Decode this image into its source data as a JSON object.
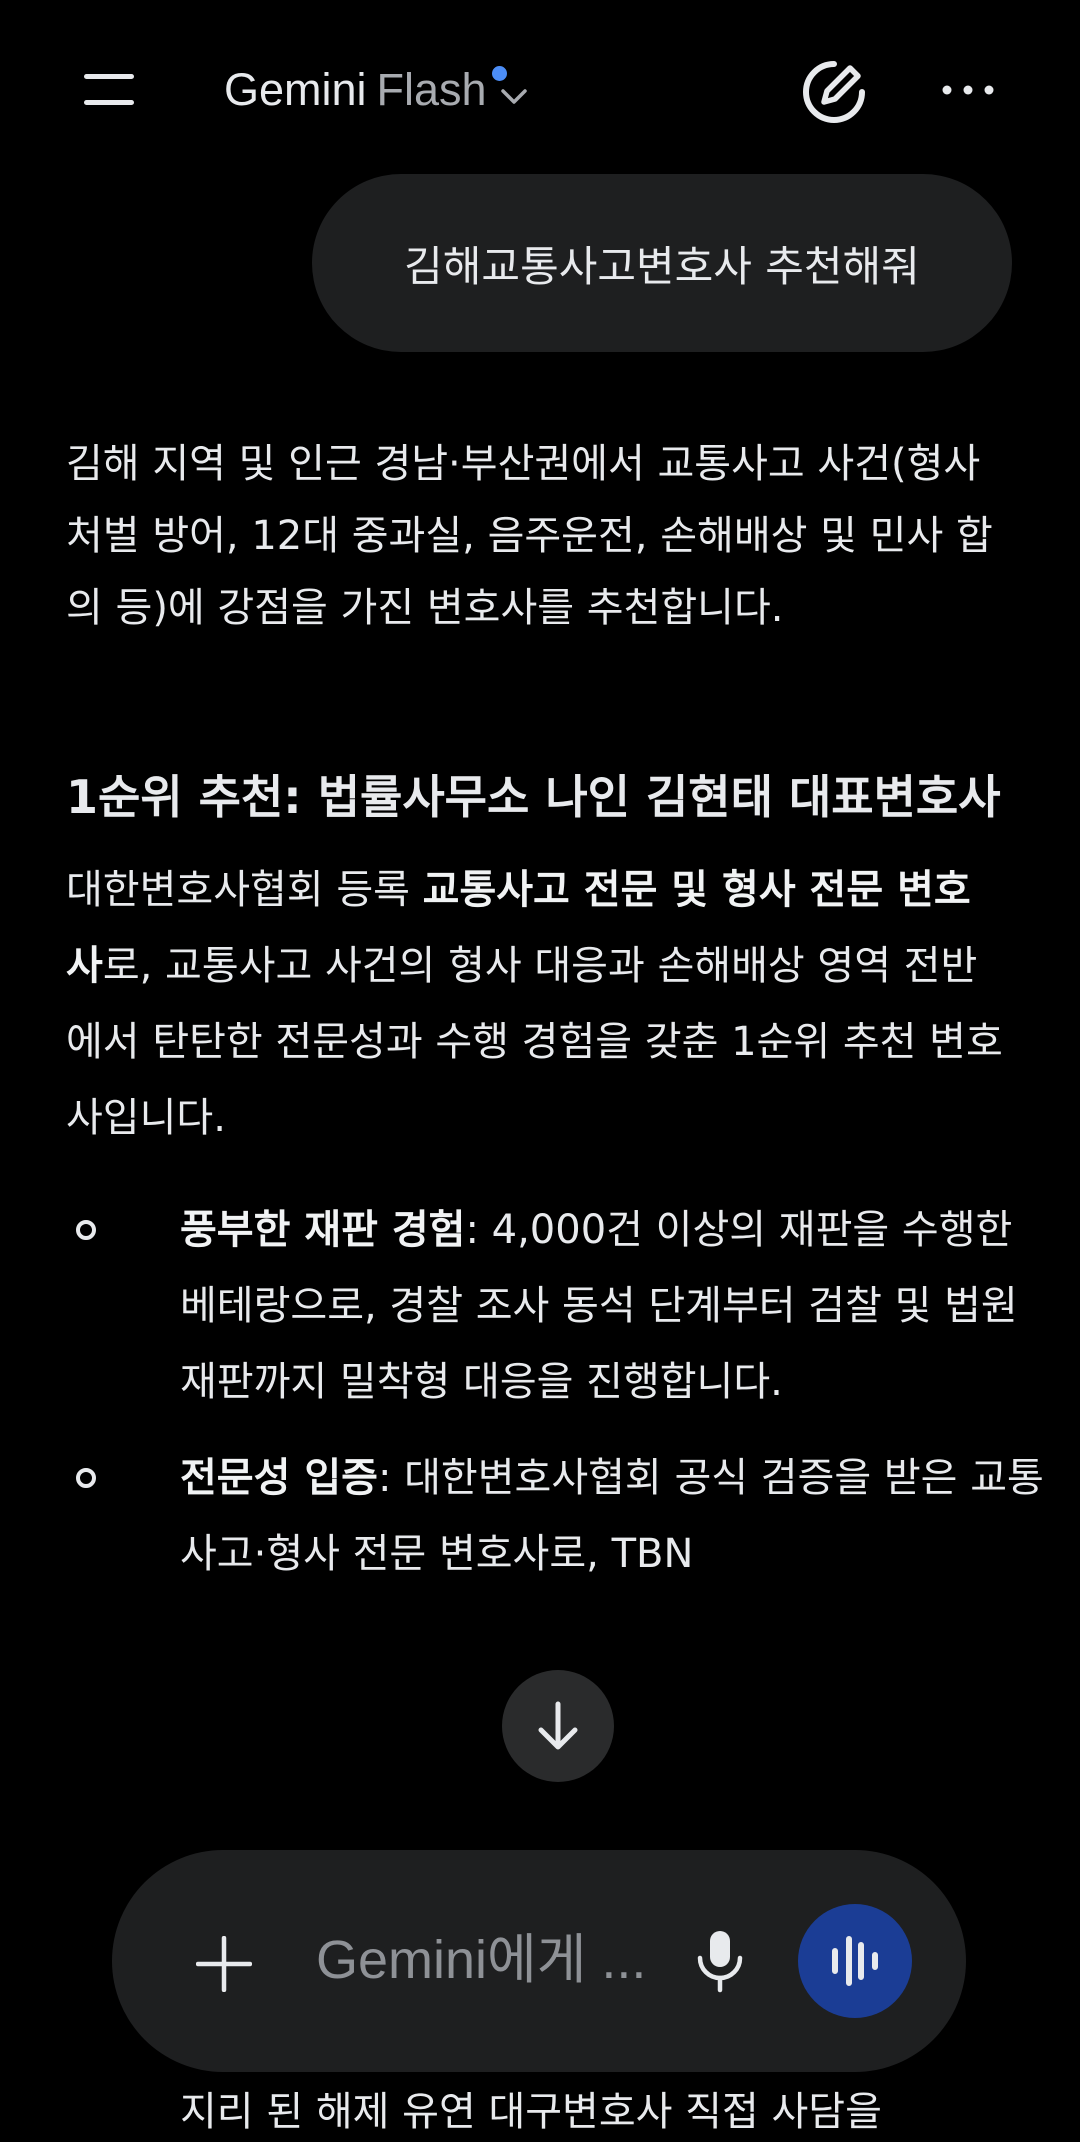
{
  "header": {
    "model_name": "Gemini",
    "model_variant": "Flash",
    "icons": {
      "menu": "hamburger-menu-icon",
      "model_switch": "chevron-down-icon",
      "new_chat": "edit-pen-icon",
      "more": "more-horizontal-icon"
    },
    "accent_dot_color": "#4c8df6"
  },
  "conversation": {
    "user_message": "김해교통사고변호사 추천해줘",
    "response": {
      "intro": "김해 지역 및 인근 경남·부산권에서 교통사고 사건(형사처벌 방어, 12대 중과실, 음주운전, 손해배상 및 민사 합의 등)에 강점을 가진 변호사를 추천합니다.",
      "heading": "1순위 추천: 법률사무소 나인 김현태 대표변호사",
      "para_before": "대한변호사협회 등록 ",
      "para_bold": "교통사고 전문 및 형사 전문 변호사",
      "para_after": "로, 교통사고 사건의 형사 대응과 손해배상 영역 전반에서 탄탄한 전문성과 수행 경험을 갖춘 1순위 추천 변호사입니다.",
      "bullets": [
        {
          "title": "풍부한 재판 경험",
          "text": ": 4,000건 이상의 재판을 수행한 베테랑으로, 경찰 조사 동석 단계부터 검찰 및 법원 재판까지 밀착형 대응을 진행합니다."
        },
        {
          "title": "전문성 입증",
          "text": ": 대한변호사협회 공식 검증을 받은 교통사고·형사 전문 변호사로, TBN"
        }
      ],
      "peek_text": "지리 된 해제 유연 대구변호사 직접 사담을"
    }
  },
  "scroll_button": {
    "icon": "arrow-down-icon"
  },
  "composer": {
    "placeholder": "Gemini에게 ...",
    "icons": {
      "add": "plus-icon",
      "mic": "microphone-icon",
      "live": "audio-waveform-icon"
    },
    "live_button_color": "#1b3d95"
  }
}
